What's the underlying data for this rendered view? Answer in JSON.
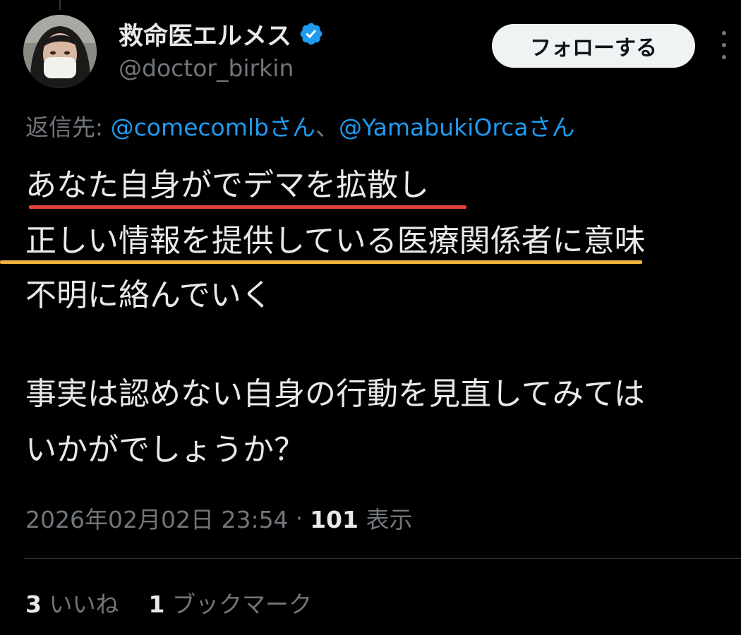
{
  "author": {
    "display_name": "救命医エルメス",
    "handle": "@doctor_birkin",
    "verified_icon": "verified-badge-icon",
    "avatar": "avatar-photo"
  },
  "actions": {
    "follow_label": "フォローする",
    "more_icon": "more-options-icon"
  },
  "reply_to": {
    "prefix": "返信先: ",
    "mentions": [
      "@comecomlbさん",
      "@YamabukiOrcaさん"
    ],
    "separator": "、"
  },
  "tweet": {
    "lines": [
      "あなた自身がでデマを拡散し",
      "正しい情報を提供している医療関係者に意味",
      "不明に絡んでいく",
      "",
      "事実は認めない自身の行動を見直してみては",
      "いかがでしょうか？"
    ],
    "highlight_colors": {
      "line1_underline": "#e3453f",
      "line2_underline": "#f2b33d"
    }
  },
  "meta": {
    "timestamp": "2026年02月02日 23:54",
    "separator": "·",
    "views_count": "101",
    "views_label": "表示"
  },
  "stats": {
    "likes_count": "3",
    "likes_label": "いいね",
    "bookmarks_count": "1",
    "bookmarks_label": "ブックマーク"
  },
  "colors": {
    "background": "#000000",
    "text_primary": "#e7e9ea",
    "text_secondary": "#71767b",
    "link": "#1d9bf0",
    "verified": "#1d9bf0"
  }
}
